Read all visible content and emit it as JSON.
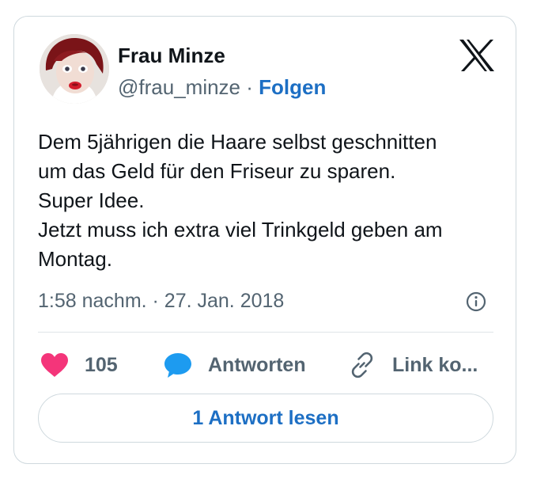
{
  "author": {
    "name": "Frau Minze",
    "handle": "@frau_minze",
    "separator": " · ",
    "follow_label": "Folgen"
  },
  "tweet": {
    "text": "Dem 5jährigen die Haare selbst geschnitten\num das Geld für den Friseur zu sparen.\nSuper Idee.\nJetzt muss ich extra viel Trinkgeld geben am\nMontag.",
    "timestamp": "1:58 nachm. · 27. Jan. 2018"
  },
  "actions": {
    "like_count": "105",
    "reply_label": "Antworten",
    "copy_link_label": "Link ko..."
  },
  "read_replies_label": "1 Antwort lesen",
  "icons": {
    "brand": "x-logo-icon",
    "info": "info-icon",
    "like": "heart-icon",
    "reply": "speech-bubble-icon",
    "link": "link-icon"
  },
  "colors": {
    "heart": "#f4357a",
    "reply_bubble": "#1d9bf0",
    "link_accent": "#1d6fc4",
    "secondary_text": "#536471",
    "border": "#cfd9de"
  }
}
